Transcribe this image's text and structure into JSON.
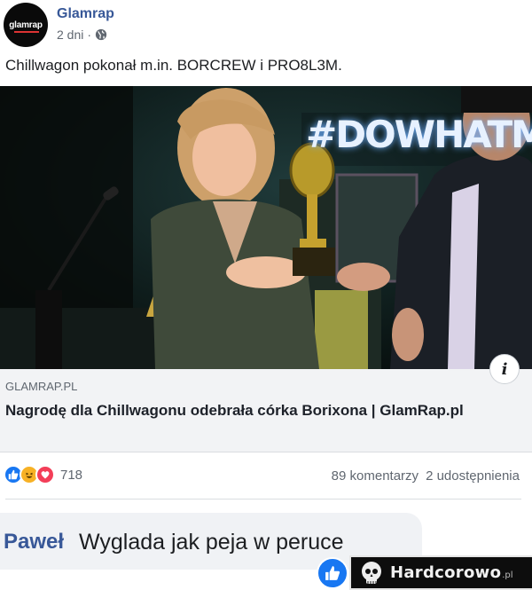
{
  "post": {
    "page_name": "Glamrap",
    "avatar_text": "glamrap",
    "time": "2 dni",
    "separator": "·",
    "audience_icon": "globe-icon",
    "text": "Chillwagon pokonał m.in. BORCREW i PRO8L3M."
  },
  "photo": {
    "stage_sign": "#DOWHATMI"
  },
  "link": {
    "domain": "GLAMRAP.PL",
    "title": "Nagrodę dla Chillwagonu odebrała córka Borixona | GlamRap.pl",
    "info_icon": "info-icon"
  },
  "stats": {
    "reactions": [
      "like",
      "haha",
      "love"
    ],
    "reaction_count": "718",
    "comments": "89 komentarzy",
    "shares": "2 udostępnienia"
  },
  "comment": {
    "author": "Paweł",
    "text": "Wyglada jak peja w peruce"
  },
  "watermark": {
    "name": "Hardcorowo",
    "suffix": ".pl"
  },
  "colors": {
    "link_blue": "#385898",
    "like_blue": "#1877f2",
    "haha_yellow": "#f7b125",
    "love_red": "#f33e58",
    "card_bg": "#f2f3f5"
  }
}
